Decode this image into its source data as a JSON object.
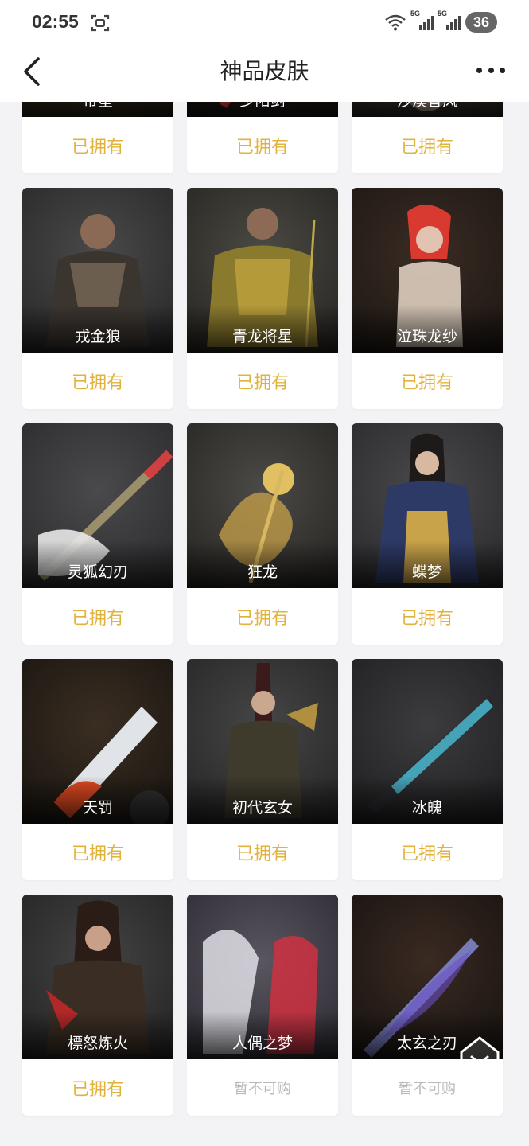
{
  "status_bar": {
    "time": "02:55",
    "network": [
      "5G",
      "5G"
    ],
    "battery": "36"
  },
  "nav": {
    "title": "神品皮肤"
  },
  "skins": [
    {
      "name": "帝星",
      "status": "已拥有",
      "available": true
    },
    {
      "name": "少阳剑",
      "status": "已拥有",
      "available": true
    },
    {
      "name": "沙漠香风",
      "status": "已拥有",
      "available": true
    },
    {
      "name": "戎金狼",
      "status": "已拥有",
      "available": true
    },
    {
      "name": "青龙将星",
      "status": "已拥有",
      "available": true
    },
    {
      "name": "泣珠龙纱",
      "status": "已拥有",
      "available": true
    },
    {
      "name": "灵狐幻刃",
      "status": "已拥有",
      "available": true
    },
    {
      "name": "狂龙",
      "status": "已拥有",
      "available": true
    },
    {
      "name": "蝶梦",
      "status": "已拥有",
      "available": true
    },
    {
      "name": "天罚",
      "status": "已拥有",
      "available": true
    },
    {
      "name": "初代玄女",
      "status": "已拥有",
      "available": true
    },
    {
      "name": "冰魄",
      "status": "已拥有",
      "available": true
    },
    {
      "name": "標怒炼火",
      "status": "已拥有",
      "available": true
    },
    {
      "name": "人偶之梦",
      "status": "暂不可购",
      "available": false
    },
    {
      "name": "太玄之刃",
      "status": "暂不可购",
      "available": false
    }
  ],
  "colors": {
    "owned": "#e2b33c",
    "unavailable": "#b9b9b9",
    "background": "#f3f3f5"
  }
}
